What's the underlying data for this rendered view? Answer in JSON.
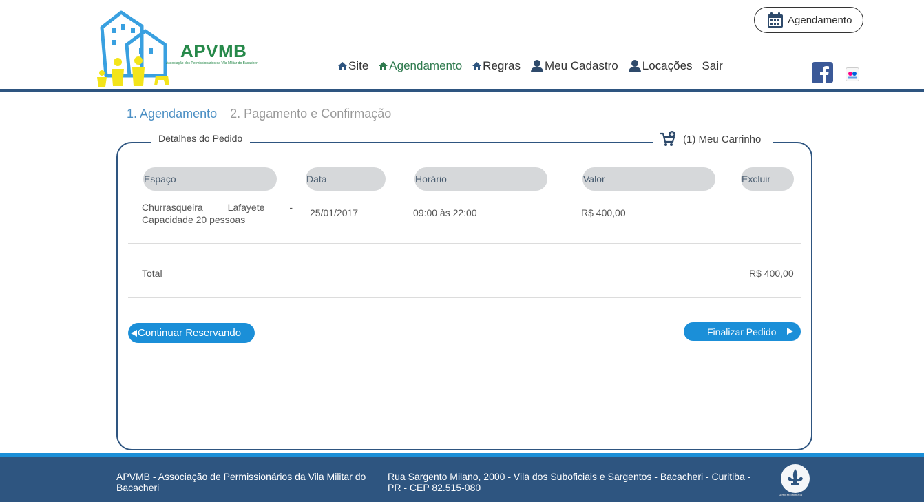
{
  "header": {
    "logo_title": "APVMB",
    "logo_subtitle": "Associação dos Permissionários da Vila Militar do Bacacheri",
    "top_button_label": "Agendamento",
    "nav": [
      {
        "label": "Site",
        "icon": "home-icon"
      },
      {
        "label": "Agendamento",
        "icon": "home-icon"
      },
      {
        "label": "Regras",
        "icon": "home-icon"
      },
      {
        "label": "Meu Cadastro",
        "icon": "user-icon"
      },
      {
        "label": "Locações",
        "icon": "user-icon"
      },
      {
        "label": "Sair",
        "icon": ""
      }
    ],
    "social": [
      "facebook-icon",
      "flickr-icon"
    ]
  },
  "steps": {
    "step1": "1. Agendamento",
    "step2": "2. Pagamento e Confirmação"
  },
  "panel": {
    "legend": "Detalhes do Pedido",
    "cart_label": "(1) Meu Carrinho",
    "columns": [
      "Espaço",
      "Data",
      "Horário",
      "Valor",
      "Excluir"
    ],
    "rows": [
      {
        "space": "Churrasqueira Lafayete - Capacidade 20 pessoas",
        "date": "25/01/2017",
        "time": "09:00 às 22:00",
        "value": "R$ 400,00",
        "delete_checked": false
      }
    ],
    "total_label": "Total",
    "total_value": "R$ 400,00",
    "continue_button": "Continuar Reservando",
    "finish_button": "Finalizar Pedido"
  },
  "footer": {
    "left_text": "APVMB - Associação de Permissionários da Vila Militar do Bacacheri",
    "right_text": "Rua Sargento Milano, 2000 - Vila dos Suboficiais e Sargentos - Bacacheri - Curitiba - PR - CEP 82.515-080",
    "badge_text": "Arte Multimídia"
  },
  "colors": {
    "primary_dark": "#2e5580",
    "accent_blue": "#1b8fd8",
    "active_green": "#2f7a4e",
    "step_active": "#4b8fc4"
  }
}
